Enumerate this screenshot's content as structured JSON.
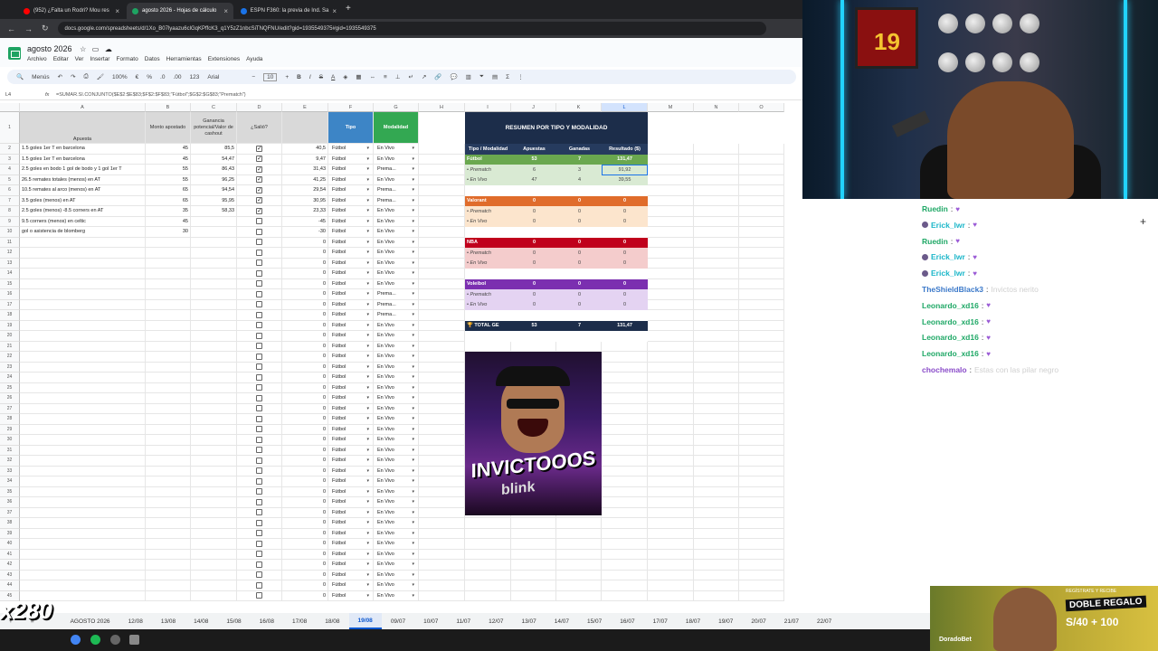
{
  "browser": {
    "tabs": [
      {
        "title": "(952) ¿Falta un Rodri? Mou res",
        "favicon_color": "#ff0000",
        "active": false
      },
      {
        "title": "agosto 2026 - Hojas de cálculo",
        "favicon_color": "#1ea362",
        "active": true
      },
      {
        "title": "ESPN F360: la previa de Ind. Sa",
        "favicon_color": "#1a73e8",
        "active": false
      }
    ],
    "url": "docs.google.com/spreadsheets/d/1Xo_B07lyaazu6clGqKPffcK3_q1Y5zZ1nbcSiTNQFNU/edit?gid=1935549375#gid=1935549375"
  },
  "sheet": {
    "title": "agosto 2026",
    "menus": [
      "Archivo",
      "Editar",
      "Ver",
      "Insertar",
      "Formato",
      "Datos",
      "Herramientas",
      "Extensiones",
      "Ayuda"
    ],
    "toolbar": {
      "search": "Menús",
      "zoom": "100%",
      "font": "Arial",
      "font_size": "10"
    },
    "cell_ref": "L4",
    "formula": "=SUMAR.SI.CONJUNTO($E$2:$E$83;$F$2:$F$83;\"Fútbol\";$G$2:$G$83;\"Prematch\")",
    "columns": [
      "A",
      "B",
      "C",
      "D",
      "E",
      "F",
      "G",
      "H",
      "I",
      "J",
      "K",
      "L",
      "M",
      "N",
      "O"
    ],
    "headers": {
      "apuesta": "Apuesta",
      "monto": "Monto apostado",
      "ganancia": "Ganancia potencial/Valor de cashout",
      "salio": "¿Salió?",
      "tipo": "Tipo",
      "modalidad": "Modalidad"
    },
    "rows": [
      {
        "n": "2",
        "a": "1.5 goles 1er T en barcelona",
        "b": "45",
        "c": "85,5",
        "d": true,
        "e": "40,5",
        "f": "Fútbol",
        "g": "En Vivo"
      },
      {
        "n": "3",
        "a": "1.5 goles 1er T en barcelona",
        "b": "45",
        "c": "54,47",
        "d": true,
        "e": "9,47",
        "f": "Fútbol",
        "g": "En Vivo"
      },
      {
        "n": "4",
        "a": "2.5 goles en bodo 1 gol de bodo y 1 gol 1er T",
        "b": "55",
        "c": "86,43",
        "d": true,
        "e": "31,43",
        "f": "Fútbol",
        "g": "Prema..."
      },
      {
        "n": "5",
        "a": "26.5 remates totales (menos) en AT",
        "b": "55",
        "c": "96,25",
        "d": true,
        "e": "41,25",
        "f": "Fútbol",
        "g": "En Vivo"
      },
      {
        "n": "6",
        "a": "10.5 remates al arco (menos) en AT",
        "b": "65",
        "c": "94,54",
        "d": true,
        "e": "29,54",
        "f": "Fútbol",
        "g": "Prema..."
      },
      {
        "n": "7",
        "a": "3.5 goles (menos) en AT",
        "b": "65",
        "c": "95,95",
        "d": true,
        "e": "30,95",
        "f": "Fútbol",
        "g": "Prema..."
      },
      {
        "n": "8",
        "a": "2.5 goles (menos) -8.5 corners en AT",
        "b": "35",
        "c": "58,33",
        "d": true,
        "e": "23,33",
        "f": "Fútbol",
        "g": "En Vivo"
      },
      {
        "n": "9",
        "a": "9.5 corners (menos) en celtic",
        "b": "45",
        "c": "",
        "d": false,
        "e": "-45",
        "f": "Fútbol",
        "g": "En Vivo"
      },
      {
        "n": "10",
        "a": "gol o asistencia de blomberg",
        "b": "30",
        "c": "",
        "d": false,
        "e": "-30",
        "f": "Fútbol",
        "g": "En Vivo"
      }
    ],
    "empty_rows": [
      {
        "n": "11",
        "g": "En Vivo"
      },
      {
        "n": "12",
        "g": "En Vivo"
      },
      {
        "n": "13",
        "g": "En Vivo"
      },
      {
        "n": "14",
        "g": "En Vivo"
      },
      {
        "n": "15",
        "g": "En Vivo"
      },
      {
        "n": "16",
        "g": "Prema..."
      },
      {
        "n": "17",
        "g": "Prema..."
      },
      {
        "n": "18",
        "g": "Prema..."
      },
      {
        "n": "19",
        "g": "En Vivo"
      },
      {
        "n": "20",
        "g": "En Vivo"
      },
      {
        "n": "21",
        "g": "En Vivo"
      },
      {
        "n": "22",
        "g": "En Vivo"
      },
      {
        "n": "23",
        "g": "En Vivo"
      },
      {
        "n": "24",
        "g": "En Vivo"
      },
      {
        "n": "25",
        "g": "En Vivo"
      },
      {
        "n": "26",
        "g": "En Vivo"
      },
      {
        "n": "27",
        "g": "En Vivo"
      },
      {
        "n": "28",
        "g": "En Vivo"
      },
      {
        "n": "29",
        "g": "En Vivo"
      },
      {
        "n": "30",
        "g": "En Vivo"
      },
      {
        "n": "31",
        "g": "En Vivo"
      },
      {
        "n": "32",
        "g": "En Vivo"
      },
      {
        "n": "33",
        "g": "En Vivo"
      },
      {
        "n": "34",
        "g": "En Vivo"
      },
      {
        "n": "35",
        "g": "En Vivo"
      },
      {
        "n": "36",
        "g": "En Vivo"
      },
      {
        "n": "37",
        "g": "En Vivo"
      },
      {
        "n": "38",
        "g": "En Vivo"
      },
      {
        "n": "39",
        "g": "En Vivo"
      },
      {
        "n": "40",
        "g": "En Vivo"
      },
      {
        "n": "41",
        "g": "En Vivo"
      },
      {
        "n": "42",
        "g": "En Vivo"
      },
      {
        "n": "43",
        "g": "En Vivo"
      },
      {
        "n": "44",
        "g": "En Vivo"
      },
      {
        "n": "45",
        "g": "En Vivo"
      }
    ],
    "empty_row_defaults": {
      "e": "0",
      "f": "Fútbol"
    },
    "summary": {
      "title": "RESUMEN POR TIPO Y MODALIDAD",
      "col_headers": [
        "Tipo / Modalidad",
        "Apuestas",
        "Ganadas",
        "Resultado ($)"
      ],
      "groups": [
        {
          "name": "Fútbol",
          "color": "#6aa84f",
          "light": "#d9ead3",
          "vals": [
            "53",
            "7",
            "131,47"
          ],
          "subs": [
            {
              "name": "• Prematch",
              "vals": [
                "6",
                "3",
                "91,92"
              ]
            },
            {
              "name": "• En Vivo",
              "vals": [
                "47",
                "4",
                "39,55"
              ]
            }
          ]
        },
        {
          "name": "Valorant",
          "color": "#e06c2b",
          "light": "#fce5cd",
          "vals": [
            "0",
            "0",
            "0"
          ],
          "subs": [
            {
              "name": "• Prematch",
              "vals": [
                "0",
                "0",
                "0"
              ]
            },
            {
              "name": "• En Vivo",
              "vals": [
                "0",
                "0",
                "0"
              ]
            }
          ]
        },
        {
          "name": "NBA",
          "color": "#c0001c",
          "light": "#f4cccc",
          "vals": [
            "0",
            "0",
            "0"
          ],
          "subs": [
            {
              "name": "• Prematch",
              "vals": [
                "0",
                "0",
                "0"
              ]
            },
            {
              "name": "• En Vivo",
              "vals": [
                "0",
                "0",
                "0"
              ]
            }
          ]
        },
        {
          "name": "Voleibol",
          "color": "#7b2fb0",
          "light": "#e4d3f2",
          "vals": [
            "0",
            "0",
            "0"
          ],
          "subs": [
            {
              "name": "• Prematch",
              "vals": [
                "0",
                "0",
                "0"
              ]
            },
            {
              "name": "• En Vivo",
              "vals": [
                "0",
                "0",
                "0"
              ]
            }
          ]
        }
      ],
      "total": {
        "label": "🏆 TOTAL GE",
        "vals": [
          "53",
          "7",
          "131,47"
        ]
      }
    },
    "meme": {
      "text": "INVICTOOOS",
      "sub": "blink"
    },
    "sheet_tabs": [
      "AGOSTO 2026",
      "12/08",
      "13/08",
      "14/08",
      "15/08",
      "16/08",
      "17/08",
      "18/08",
      "19/08",
      "09/07",
      "10/07",
      "11/07",
      "12/07",
      "13/07",
      "14/07",
      "15/07",
      "16/07",
      "17/07",
      "18/07",
      "19/07",
      "20/07",
      "21/07",
      "22/07"
    ],
    "active_tab": "19/08"
  },
  "webcam": {
    "jersey_number": "19"
  },
  "chat": [
    {
      "user": "Ruedin",
      "color": "#1fa866",
      "msg": "",
      "badge": false
    },
    {
      "user": "Erick_lwr",
      "color": "#1bb6c9",
      "msg": "",
      "badge": true
    },
    {
      "user": "Ruedin",
      "color": "#1fa866",
      "msg": "",
      "badge": false
    },
    {
      "user": "Erick_lwr",
      "color": "#1bb6c9",
      "msg": "",
      "badge": true
    },
    {
      "user": "Erick_lwr",
      "color": "#1bb6c9",
      "msg": "",
      "badge": true
    },
    {
      "user": "TheShieldBlack3",
      "color": "#3a78c9",
      "msg": "Invictos nerito",
      "badge": false
    },
    {
      "user": "Leonardo_xd16",
      "color": "#1fa866",
      "msg": "",
      "badge": false
    },
    {
      "user": "Leonardo_xd16",
      "color": "#1fa866",
      "msg": "",
      "badge": false
    },
    {
      "user": "Leonardo_xd16",
      "color": "#1fa866",
      "msg": "",
      "badge": false
    },
    {
      "user": "Leonardo_xd16",
      "color": "#1fa866",
      "msg": "",
      "badge": false
    },
    {
      "user": "chochemalo",
      "color": "#8a4cc9",
      "msg": "Estas con las pilar negro",
      "badge": false
    }
  ],
  "ad": {
    "top": "REGÍSTRATE Y RECIBE",
    "title": "DOBLE REGALO",
    "amount": "S/40 + 100",
    "brand": "DoradoBet"
  },
  "counter": "x280"
}
